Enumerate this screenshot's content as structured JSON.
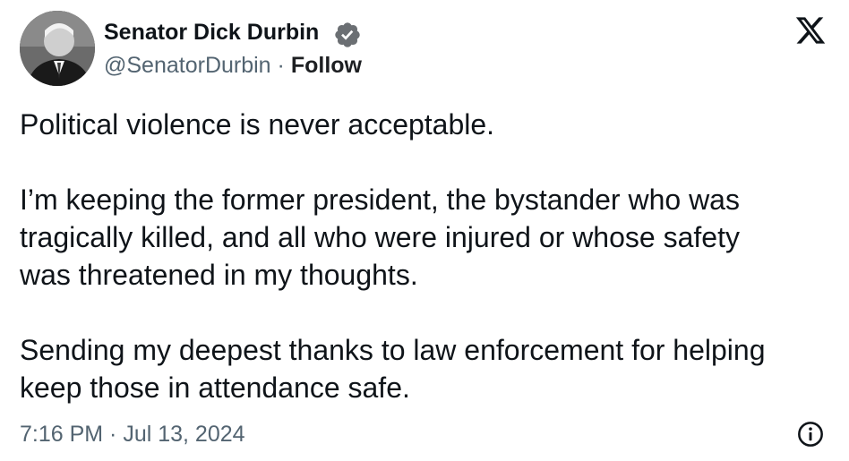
{
  "author": {
    "display_name": "Senator Dick Durbin",
    "handle": "@SenatorDurbin",
    "separator": "·",
    "follow_label": "Follow",
    "avatar": "avatar-photo",
    "verified_icon": "verified-badge-icon"
  },
  "brand": {
    "logo": "x-logo-icon"
  },
  "tweet": {
    "line1": "Political violence is never acceptable.",
    "line2": "I’m keeping the former president, the bystander who was",
    "line3": "tragically killed, and all who were injured or whose safety",
    "line4": "was threatened in my thoughts.",
    "line5": "Sending my deepest thanks to law enforcement for helping",
    "line6": "keep those in attendance safe."
  },
  "footer": {
    "timestamp": "7:16 PM · Jul 13, 2024",
    "info_icon": "info-icon"
  },
  "colors": {
    "text": "#0f1419",
    "secondary": "#536471",
    "background": "#ffffff"
  }
}
